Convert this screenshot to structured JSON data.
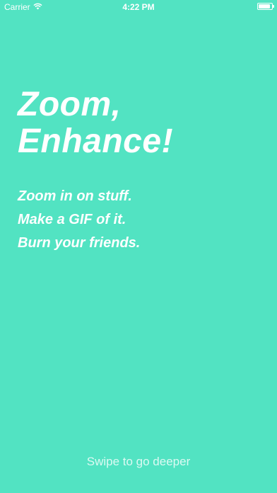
{
  "status_bar": {
    "carrier": "Carrier",
    "time": "4:22 PM",
    "wifi_icon": "wifi-icon",
    "battery_icon": "battery-icon",
    "battery_level": 0.9
  },
  "hero": {
    "title_line1": "Zoom,",
    "title_line2": "Enhance!"
  },
  "taglines": [
    "Zoom in on stuff.",
    "Make a GIF of it.",
    "Burn your friends."
  ],
  "footer": {
    "hint": "Swipe to go deeper"
  },
  "colors": {
    "background": "#52e3c2",
    "text": "#ffffff"
  }
}
